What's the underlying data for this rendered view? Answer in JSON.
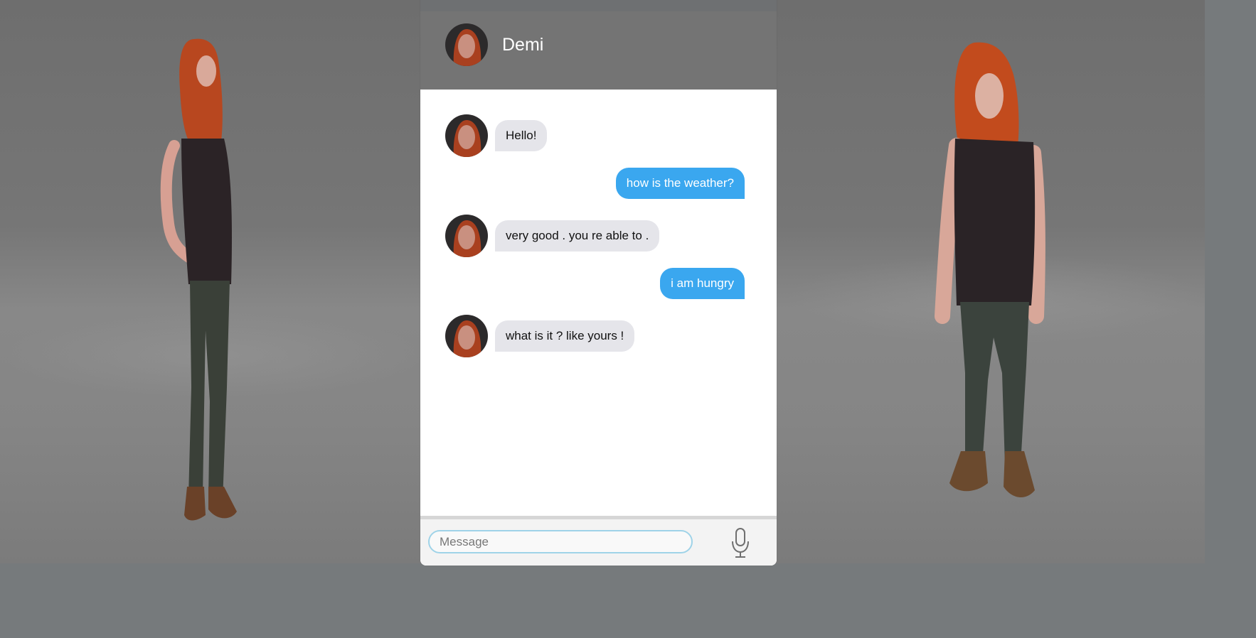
{
  "chat": {
    "contact_name": "Demi",
    "messages": [
      {
        "sender": "bot",
        "text": "Hello!"
      },
      {
        "sender": "user",
        "text": "how is the weather?"
      },
      {
        "sender": "bot",
        "text": "very good . you re able to ."
      },
      {
        "sender": "user",
        "text": "i am hungry"
      },
      {
        "sender": "bot",
        "text": "what is it ? like yours !"
      }
    ],
    "input": {
      "placeholder": "Message",
      "value": ""
    },
    "icons": {
      "mic": "microphone-icon"
    }
  },
  "colors": {
    "header_bg": "#747474",
    "user_bubble": "#3aa7ef",
    "bot_bubble": "#e5e5ea",
    "input_border": "#9fd3e8"
  }
}
